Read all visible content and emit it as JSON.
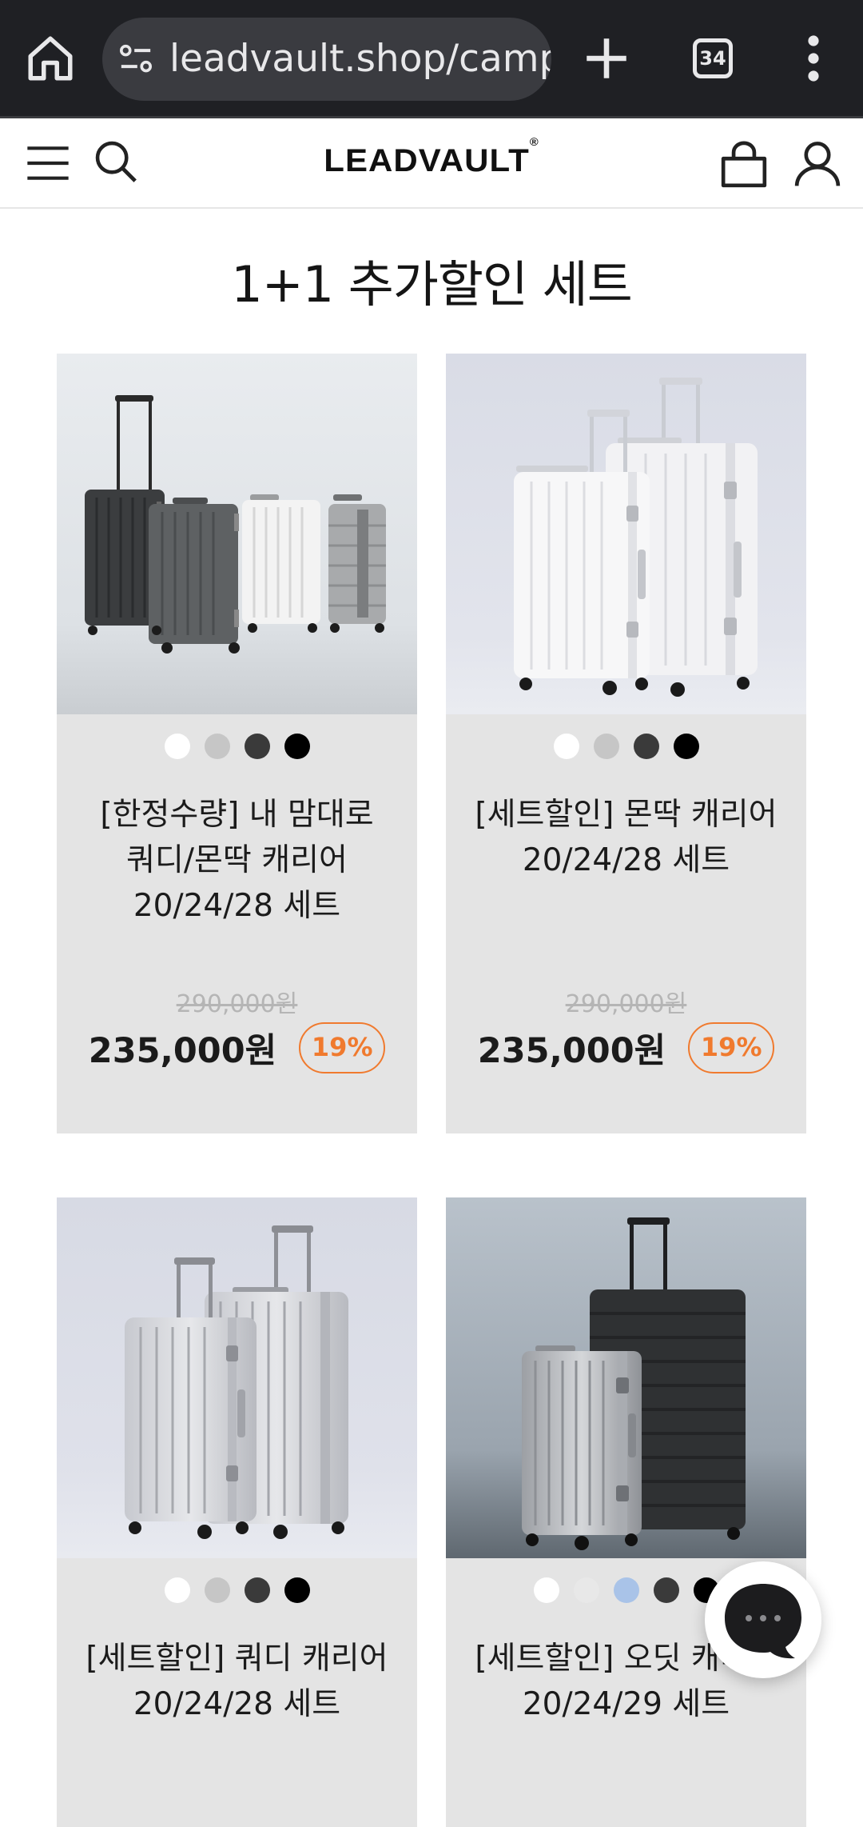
{
  "browser": {
    "url": "leadvault.shop/campa",
    "tab_count": "34",
    "icons": [
      "home-icon",
      "site-settings-icon",
      "new-tab-icon",
      "tab-switcher-icon",
      "more-options-icon"
    ]
  },
  "header": {
    "logo": "LEADVAULT",
    "logo_mark": "®",
    "icons": [
      "menu-icon",
      "search-icon",
      "cart-icon",
      "account-icon"
    ]
  },
  "section": {
    "title": "1+1 추가할인 세트"
  },
  "colors": {
    "accent": "#f07a2e",
    "card_bg": "#e4e4e4",
    "swatch_white": "#ffffff",
    "swatch_gray": "#c6c6c6",
    "swatch_dark": "#3a3a3a",
    "swatch_black": "#000000",
    "swatch_light_gray": "#e8e8e8",
    "swatch_blue": "#a9c3e8"
  },
  "products": [
    {
      "name_lines": [
        "[한정수량] 내 맘대로",
        "쿼디/몬딱 캐리어",
        "20/24/28 세트"
      ],
      "original_price": "290,000원",
      "sale_price": "235,000원",
      "discount": "19%",
      "swatches": [
        "#ffffff",
        "#c6c6c6",
        "#3a3a3a",
        "#000000"
      ]
    },
    {
      "name_lines": [
        "[세트할인] 몬딱 캐리어",
        "20/24/28 세트"
      ],
      "original_price": "290,000원",
      "sale_price": "235,000원",
      "discount": "19%",
      "swatches": [
        "#ffffff",
        "#c6c6c6",
        "#3a3a3a",
        "#000000"
      ]
    },
    {
      "name_lines": [
        "[세트할인] 쿼디 캐리어",
        "20/24/28 세트"
      ],
      "swatches": [
        "#ffffff",
        "#c6c6c6",
        "#3a3a3a",
        "#000000"
      ]
    },
    {
      "name_lines": [
        "[세트할인] 오딧 캐리어",
        "20/24/29 세트"
      ],
      "swatches": [
        "#ffffff",
        "#e8e8e8",
        "#a9c3e8",
        "#3a3a3a",
        "#000000"
      ]
    }
  ],
  "chat_button": {
    "icon": "chat-icon"
  }
}
